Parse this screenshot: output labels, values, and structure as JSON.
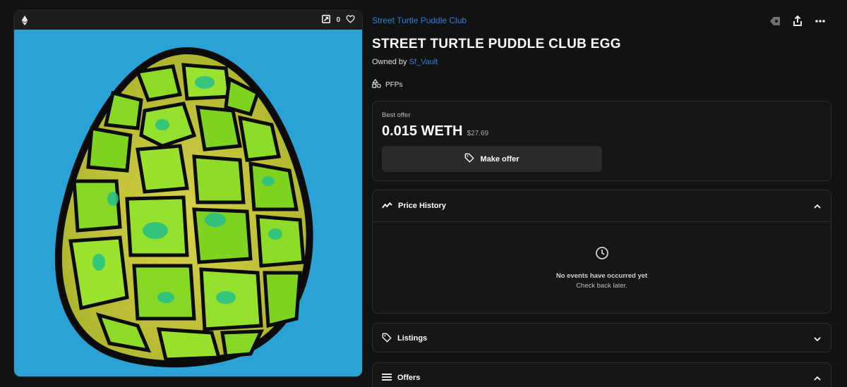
{
  "media": {
    "chain_icon": "ethereum-icon",
    "expand_icon": "expand-icon",
    "favorite_count": "0",
    "favorite_icon": "heart-icon",
    "background_color": "#2aa2d6"
  },
  "collection": {
    "name": "Street Turtle Puddle Club"
  },
  "item": {
    "title": "STREET TURTLE PUDDLE CLUB EGG",
    "owned_by_label": "Owned by",
    "owner": "Sf_Vault",
    "category": "PFPs"
  },
  "actions": {
    "icons": [
      "tag-diamond-icon",
      "share-icon",
      "more-icon"
    ]
  },
  "offer": {
    "best_label": "Best offer",
    "price": "0.015 WETH",
    "usd": "$27.69",
    "button_label": "Make offer"
  },
  "price_history": {
    "label": "Price History",
    "empty_title": "No events have occurred yet",
    "empty_sub": "Check back later."
  },
  "listings": {
    "label": "Listings"
  },
  "offers": {
    "label": "Offers"
  },
  "colors": {
    "link": "#2e7fdc",
    "accent_bg": "#121212"
  }
}
